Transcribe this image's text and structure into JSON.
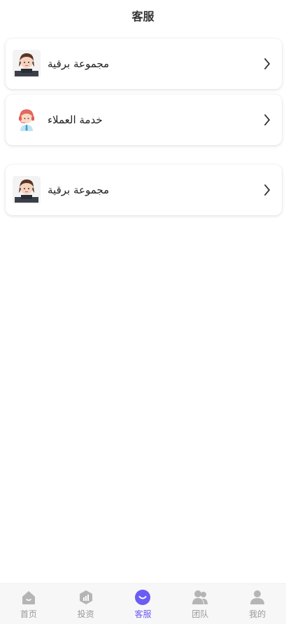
{
  "header": {
    "title": "客服"
  },
  "cards": [
    {
      "label": "مجموعة برقية",
      "avatar_icon": "agent-avatar-icon"
    },
    {
      "label": "خدمة العملاء",
      "avatar_icon": "headset-agent-icon"
    },
    {
      "label": "مجموعة برقية",
      "avatar_icon": "agent-avatar-icon"
    }
  ],
  "tabbar": {
    "active_color": "#6a5cf5",
    "inactive_color": "#999999",
    "items": [
      {
        "label": "首页",
        "icon": "home-icon"
      },
      {
        "label": "投资",
        "icon": "invest-icon"
      },
      {
        "label": "客服",
        "icon": "service-icon"
      },
      {
        "label": "团队",
        "icon": "team-icon"
      },
      {
        "label": "我的",
        "icon": "profile-icon"
      }
    ]
  }
}
